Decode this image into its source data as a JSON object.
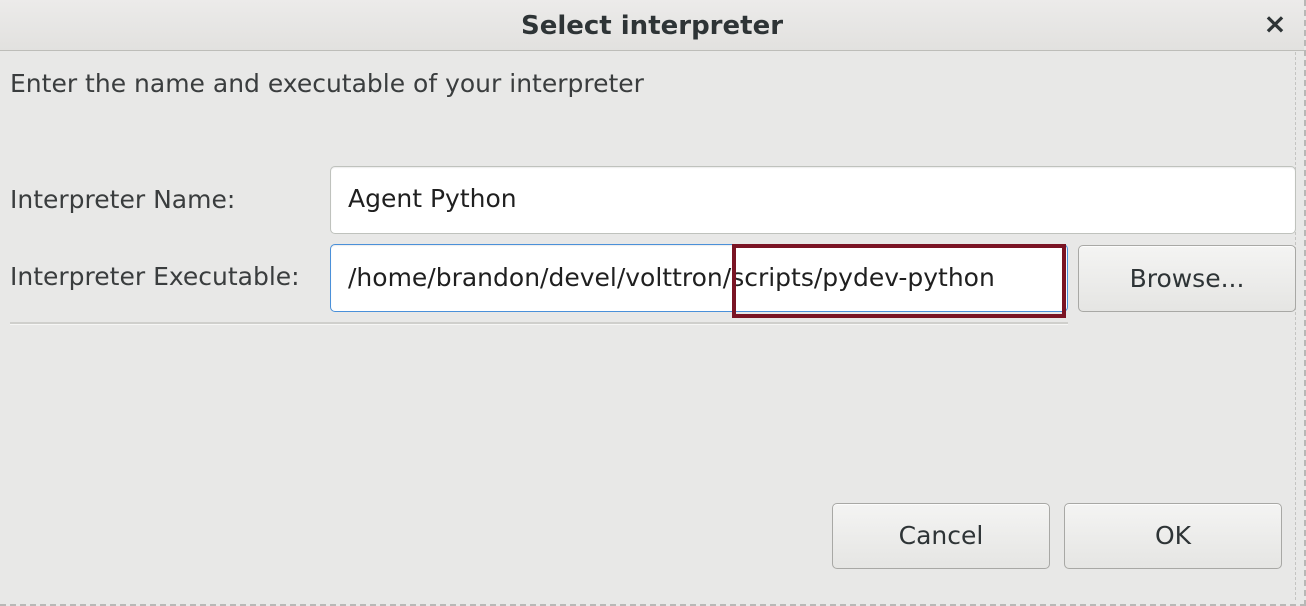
{
  "window": {
    "title": "Select interpreter",
    "close_icon": "×"
  },
  "dialog": {
    "prompt": "Enter the name and executable of your interpreter",
    "interpreter_name": {
      "label": "Interpreter Name:",
      "value": "Agent Python"
    },
    "interpreter_executable": {
      "label": "Interpreter Executable:",
      "value": "/home/brandon/devel/volttron/scripts/pydev-python",
      "highlighted_segment": "/scripts/pydev-python",
      "highlight_color": "#7a1424"
    },
    "browse_label": "Browse..."
  },
  "buttons": {
    "cancel_label": "Cancel",
    "ok_label": "OK"
  },
  "colors": {
    "focus_border": "#4a90d9",
    "background": "#e8e8e7"
  }
}
